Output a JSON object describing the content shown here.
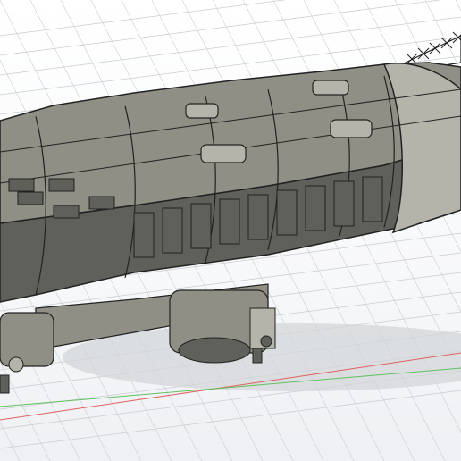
{
  "viewport": {
    "background": "#ffffff",
    "grid_color": "#c9ccd1",
    "axis_x_color": "#e06060",
    "axis_z_color": "#60c060",
    "shadow_color": "#d3d5d8"
  },
  "model": {
    "hull_color": "#8f8f86",
    "hull_dark": "#5f605a",
    "hull_light": "#b4b4ab",
    "edge_color": "#222222",
    "parts": [
      "hull",
      "nose-cone",
      "engine-pods",
      "gondola",
      "truss",
      "landing-gear"
    ]
  }
}
